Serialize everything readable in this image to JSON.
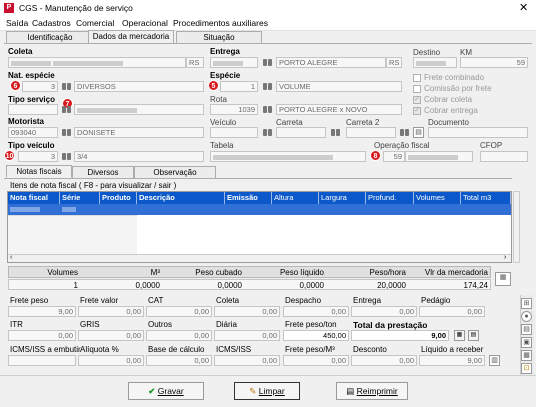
{
  "window": {
    "title": "CGS - Manutenção de serviço",
    "close": "✕"
  },
  "menu": [
    "Saída",
    "Cadastros",
    "Comercial",
    "Operacional",
    "Procedimentos auxiliares"
  ],
  "tabs": [
    "Identificação",
    "Dados da mercadoria",
    "Situação"
  ],
  "markers": [
    "6",
    "5",
    "7",
    "10",
    "8"
  ],
  "form": {
    "coleta": {
      "label": "Coleta",
      "uf": "RS"
    },
    "entrega": {
      "label": "Entrega",
      "city": "PORTO ALEGRE",
      "uf": "RS"
    },
    "destino": {
      "label": "Destino"
    },
    "km": {
      "label": "KM",
      "value": "59"
    },
    "nat_especie": {
      "label": "Nat. espécie",
      "code": "3",
      "value": "DIVERSOS"
    },
    "especie": {
      "label": "Espécie",
      "code": "1",
      "value": "VOLUME"
    },
    "tipo_servico": {
      "label": "Tipo serviço"
    },
    "rota": {
      "label": "Rota",
      "code": "1039",
      "value": "PORTO ALEGRE  x NOVO"
    },
    "motorista": {
      "label": "Motorista",
      "code": "093040",
      "value": "DONISETE"
    },
    "veiculo": {
      "label": "Veículo"
    },
    "carreta": {
      "label": "Carreta"
    },
    "carreta2": {
      "label": "Carreta 2"
    },
    "documento": {
      "label": "Documento"
    },
    "tipo_veiculo": {
      "label": "Tipo veículo",
      "code": "3",
      "value": "3/4"
    },
    "tabela": {
      "label": "Tabela"
    },
    "operacao_fiscal": {
      "label": "Operação fiscal",
      "value": "59"
    },
    "cfop": {
      "label": "CFOP"
    },
    "checkboxes": [
      "Frete combinado",
      "Comissão por frete",
      "Cobrar coleta",
      "Cobrar entrega"
    ]
  },
  "subtabs": [
    "Notas fiscais",
    "Diversos",
    "Observação"
  ],
  "notas": {
    "caption": "Itens de nota fiscal ( F8 - para visualizar / sair )",
    "columns": [
      "Nota fiscal",
      "Série",
      "Produto",
      "Descrição",
      "Emissão",
      "Altura",
      "Largura",
      "Profund.",
      "Volumes",
      "Total m3"
    ]
  },
  "totals": {
    "headers": [
      "Volumes",
      "M³",
      "Peso cubado",
      "Peso líquido",
      "Peso/hora",
      "Vlr da mercadoria"
    ],
    "values": [
      "1",
      "0,0000",
      "0,0000",
      "0,0000",
      "20,0000",
      "174,24"
    ]
  },
  "frete": {
    "row1": [
      {
        "label": "Frete peso",
        "value": "9,00"
      },
      {
        "label": "Frete valor",
        "value": "0,00"
      },
      {
        "label": "CAT",
        "value": "0,00"
      },
      {
        "label": "Coleta",
        "value": "0,00"
      },
      {
        "label": "Despacho",
        "value": "0,00"
      },
      {
        "label": "Entrega",
        "value": "0,00"
      },
      {
        "label": "Pedágio",
        "value": "0,00"
      }
    ],
    "row2": [
      {
        "label": "ITR",
        "value": "0,00"
      },
      {
        "label": "GRIS",
        "value": "0,00"
      },
      {
        "label": "Outros",
        "value": "0,00"
      },
      {
        "label": "Diária",
        "value": "0,00"
      },
      {
        "label": "Frete peso/ton",
        "value": "450,00"
      }
    ],
    "total_label": "Total da prestação",
    "total_value": "9,00",
    "row3": [
      {
        "label": "ICMS/ISS a embutir",
        "value": ""
      },
      {
        "label": "Alíquota %",
        "value": "0,00"
      },
      {
        "label": "Base de cálculo",
        "value": "0,00"
      },
      {
        "label": "ICMS/ISS",
        "value": "0,00"
      },
      {
        "label": "Frete peso/M³",
        "value": "0,00"
      },
      {
        "label": "Desconto",
        "value": "0,00"
      },
      {
        "label": "Líquido a receber",
        "value": "9,00"
      }
    ]
  },
  "buttons": {
    "gravar": "Gravar",
    "limpar": "Limpar",
    "reimprimir": "Reimprimir"
  },
  "sidebar": [
    "⊞",
    "●",
    "▤",
    "▣",
    "▦",
    "⊡",
    "▥",
    "▧"
  ],
  "colors": {
    "grid_header": "#0a58ca",
    "marker": "#d7191c"
  }
}
